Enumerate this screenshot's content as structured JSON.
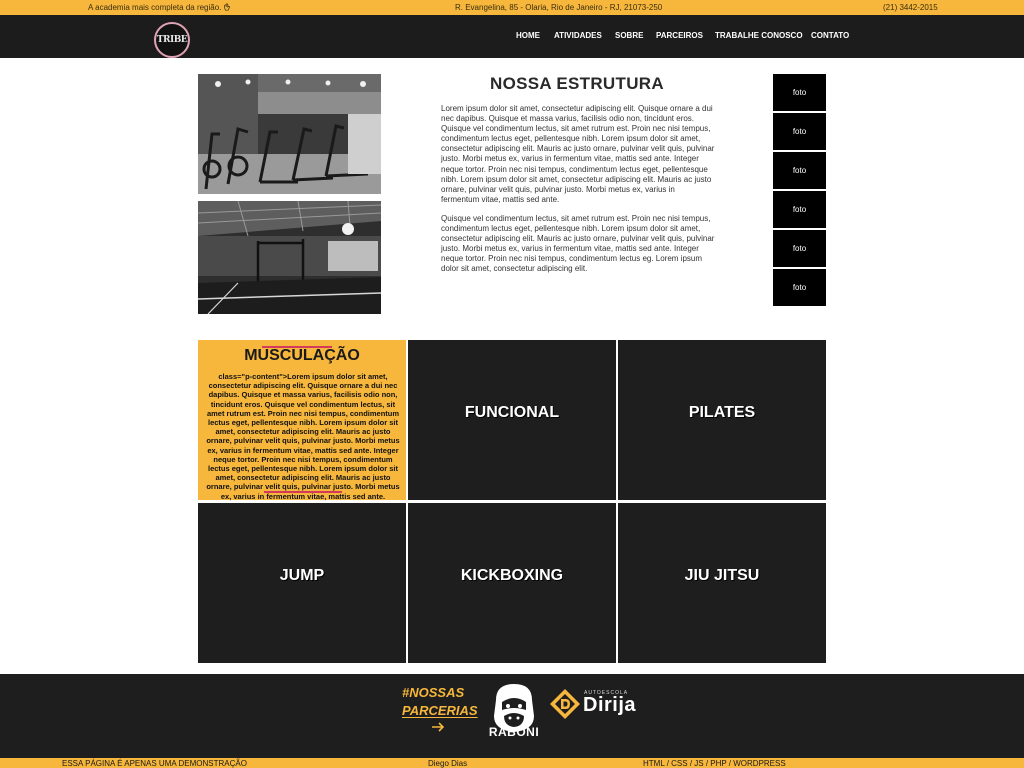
{
  "topbar": {
    "tagline": "A academia mais completa da região.",
    "address": "R. Evangelina, 85 - Olaria, Rio de Janeiro - RJ, 21073-250",
    "phone": "(21) 3442-2015"
  },
  "header": {
    "logo_text": "TRIBE",
    "nav": [
      "HOME",
      "ATIVIDADES",
      "SOBRE",
      "PARCEIROS",
      "TRABALHE CONOSCO",
      "CONTATO"
    ]
  },
  "estrutura": {
    "title": "NOSSA ESTRUTURA",
    "paragraph1": "Lorem ipsum dolor sit amet, consectetur adipiscing elit. Quisque ornare a dui nec dapibus. Quisque et massa varius, facilisis odio non, tincidunt eros. Quisque vel condimentum lectus, sit amet rutrum est. Proin nec nisi tempus, condimentum lectus eget, pellentesque nibh. Lorem ipsum dolor sit amet, consectetur adipiscing elit. Mauris ac justo ornare, pulvinar velit quis, pulvinar justo. Morbi metus ex, varius in fermentum vitae, mattis sed ante. Integer neque tortor. Proin nec nisi tempus, condimentum lectus eget, pellentesque nibh. Lorem ipsum dolor sit amet, consectetur adipiscing elit. Mauris ac justo ornare, pulvinar velit quis, pulvinar justo. Morbi metus ex, varius in fermentum vitae, mattis sed ante.",
    "paragraph2": "Quisque vel condimentum lectus, sit amet rutrum est. Proin nec nisi tempus, condimentum lectus eget, pellentesque nibh. Lorem ipsum dolor sit amet, consectetur adipiscing elit. Mauris ac justo ornare, pulvinar velit quis, pulvinar justo. Morbi metus ex, varius in fermentum vitae, mattis sed ante. Integer neque tortor. Proin nec nisi tempus, condimentum lectus eg. Lorem ipsum dolor sit amet, consectetur adipiscing elit.",
    "foto_buttons": [
      "foto",
      "foto",
      "foto",
      "foto",
      "foto",
      "foto"
    ]
  },
  "atividades": {
    "active": {
      "title": "MUSCULAÇÃO",
      "body": "class=\"p-content\">Lorem ipsum dolor sit amet, consectetur adipiscing elit. Quisque ornare a dui nec dapibus. Quisque et massa varius, facilisis odio non, tincidunt eros. Quisque vel condimentum lectus, sit amet rutrum est. Proin nec nisi tempus, condimentum lectus eget, pellentesque nibh. Lorem ipsum dolor sit amet, consectetur adipiscing elit. Mauris ac justo ornare, pulvinar velit quis, pulvinar justo. Morbi metus ex, varius in fermentum vitae, mattis sed ante. Integer neque tortor. Proin nec nisi tempus, condimentum lectus eget, pellentesque nibh. Lorem ipsum dolor sit amet, consectetur adipiscing elit. Mauris ac justo ornare, pulvinar velit quis, pulvinar justo. Morbi metus ex, varius in fermentum vitae, mattis sed ante."
    },
    "items": [
      "FUNCIONAL",
      "PILATES",
      "JUMP",
      "KICKBOXING",
      "JIU JITSU"
    ]
  },
  "parcerias": {
    "title_line1": "#NOSSAS",
    "title_line2": "PARCERIAS",
    "partner1": "RABONI",
    "partner2_sub": "AUTOESCOLA",
    "partner2": "Dirija"
  },
  "bottom": {
    "disclaimer": "ESSA PÁGINA É APENAS UMA DEMONSTRAÇÃO",
    "author": "Diego Dias",
    "tech": "HTML / CSS / JS / PHP / WORDPRESS"
  },
  "colors": {
    "accent": "#f6b73c",
    "dark": "#1e1e1e",
    "highlight": "#d23b5a"
  }
}
